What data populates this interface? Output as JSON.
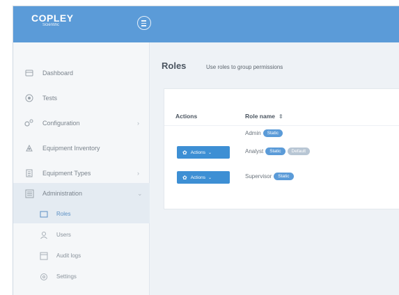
{
  "header": {
    "brand_name": "COPLEY",
    "brand_sub": "Scientific"
  },
  "sidebar": {
    "items": [
      {
        "label": "Dashboard",
        "icon": "dashboard-icon"
      },
      {
        "label": "Tests",
        "icon": "tests-icon"
      },
      {
        "label": "Configuration",
        "icon": "config-icon",
        "expandable": true
      },
      {
        "label": "Equipment Inventory",
        "icon": "inventory-icon"
      },
      {
        "label": "Equipment Types",
        "icon": "types-icon",
        "expandable": true
      },
      {
        "label": "Administration",
        "icon": "admin-icon",
        "expanded": true
      }
    ],
    "subitems": [
      {
        "label": "Roles",
        "icon": "roles-icon",
        "active": true
      },
      {
        "label": "Users",
        "icon": "users-icon"
      },
      {
        "label": "Audit logs",
        "icon": "audit-icon"
      },
      {
        "label": "Settings",
        "icon": "settings-icon"
      }
    ]
  },
  "main": {
    "title": "Roles",
    "subtitle": "Use roles to group permissions",
    "table": {
      "headers": {
        "actions": "Actions",
        "role_name": "Role name"
      },
      "actions_label": "Actions",
      "rows": [
        {
          "name": "Admin",
          "badges": [
            "Static"
          ],
          "has_actions": false
        },
        {
          "name": "Analyst",
          "badges": [
            "Static",
            "Default"
          ],
          "has_actions": true
        },
        {
          "name": "Supervisor",
          "badges": [
            "Static"
          ],
          "has_actions": true
        }
      ]
    }
  },
  "colors": {
    "header": "#5b9bd8",
    "primary_button": "#3d8fd4",
    "badge_static": "#5b9bd8",
    "badge_default": "#b8c6d4"
  }
}
